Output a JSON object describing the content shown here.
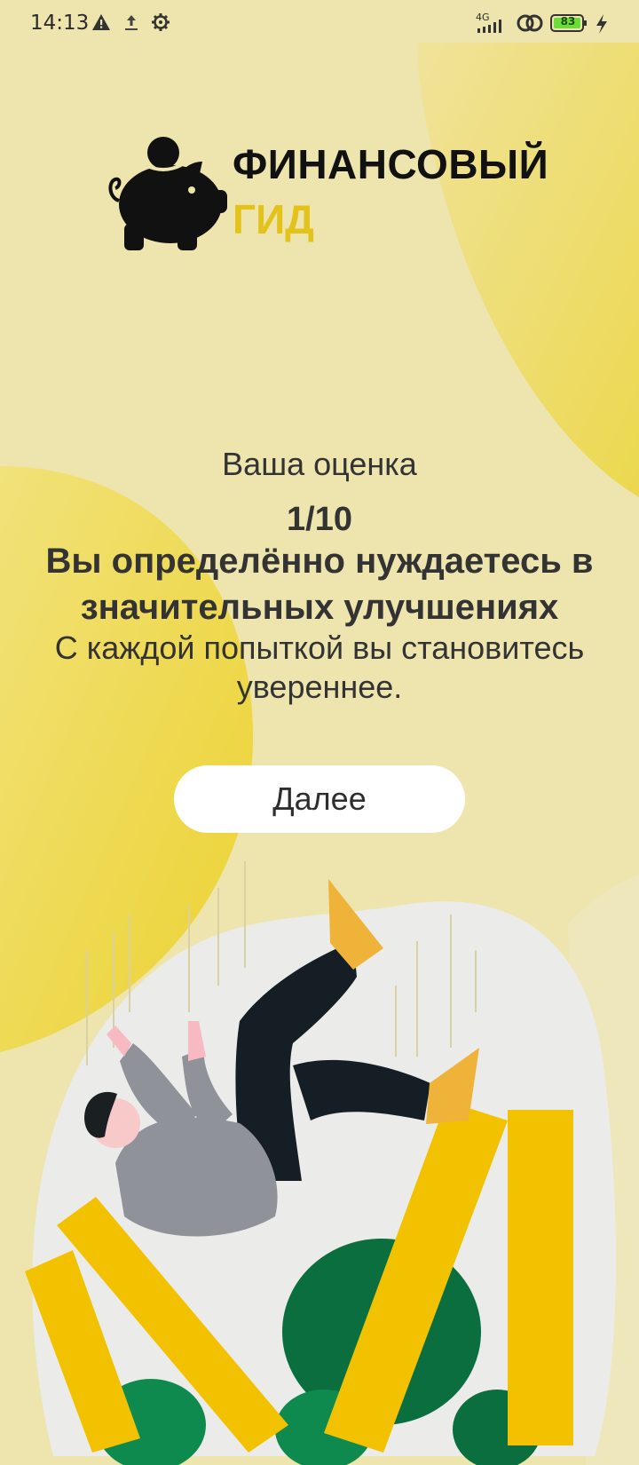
{
  "status_bar": {
    "time": "14:13",
    "network": "4G",
    "battery": "83",
    "left_icons": [
      "warning-icon",
      "upload-icon",
      "settings-gear-icon"
    ],
    "right_icons": [
      "signal-icon",
      "link-icon",
      "battery-icon",
      "charging-icon"
    ]
  },
  "brand": {
    "line1": "ФИНАНСОВЫЙ",
    "line2": "ГИД",
    "logo_icon": "piggy-bank-icon",
    "accent_color": "#e3c21a"
  },
  "result": {
    "label": "Ваша оценка",
    "score": "1/10",
    "verdict": "Вы определённо нуждаетесь в значительных улучшениях",
    "encouragement": "С каждой попыткой вы становитесь увереннее."
  },
  "actions": {
    "next_label": "Далее"
  },
  "colors": {
    "background": "#ede5ad",
    "accent_yellow": "#f2c200",
    "button_bg": "#ffffff",
    "text": "#333333"
  }
}
